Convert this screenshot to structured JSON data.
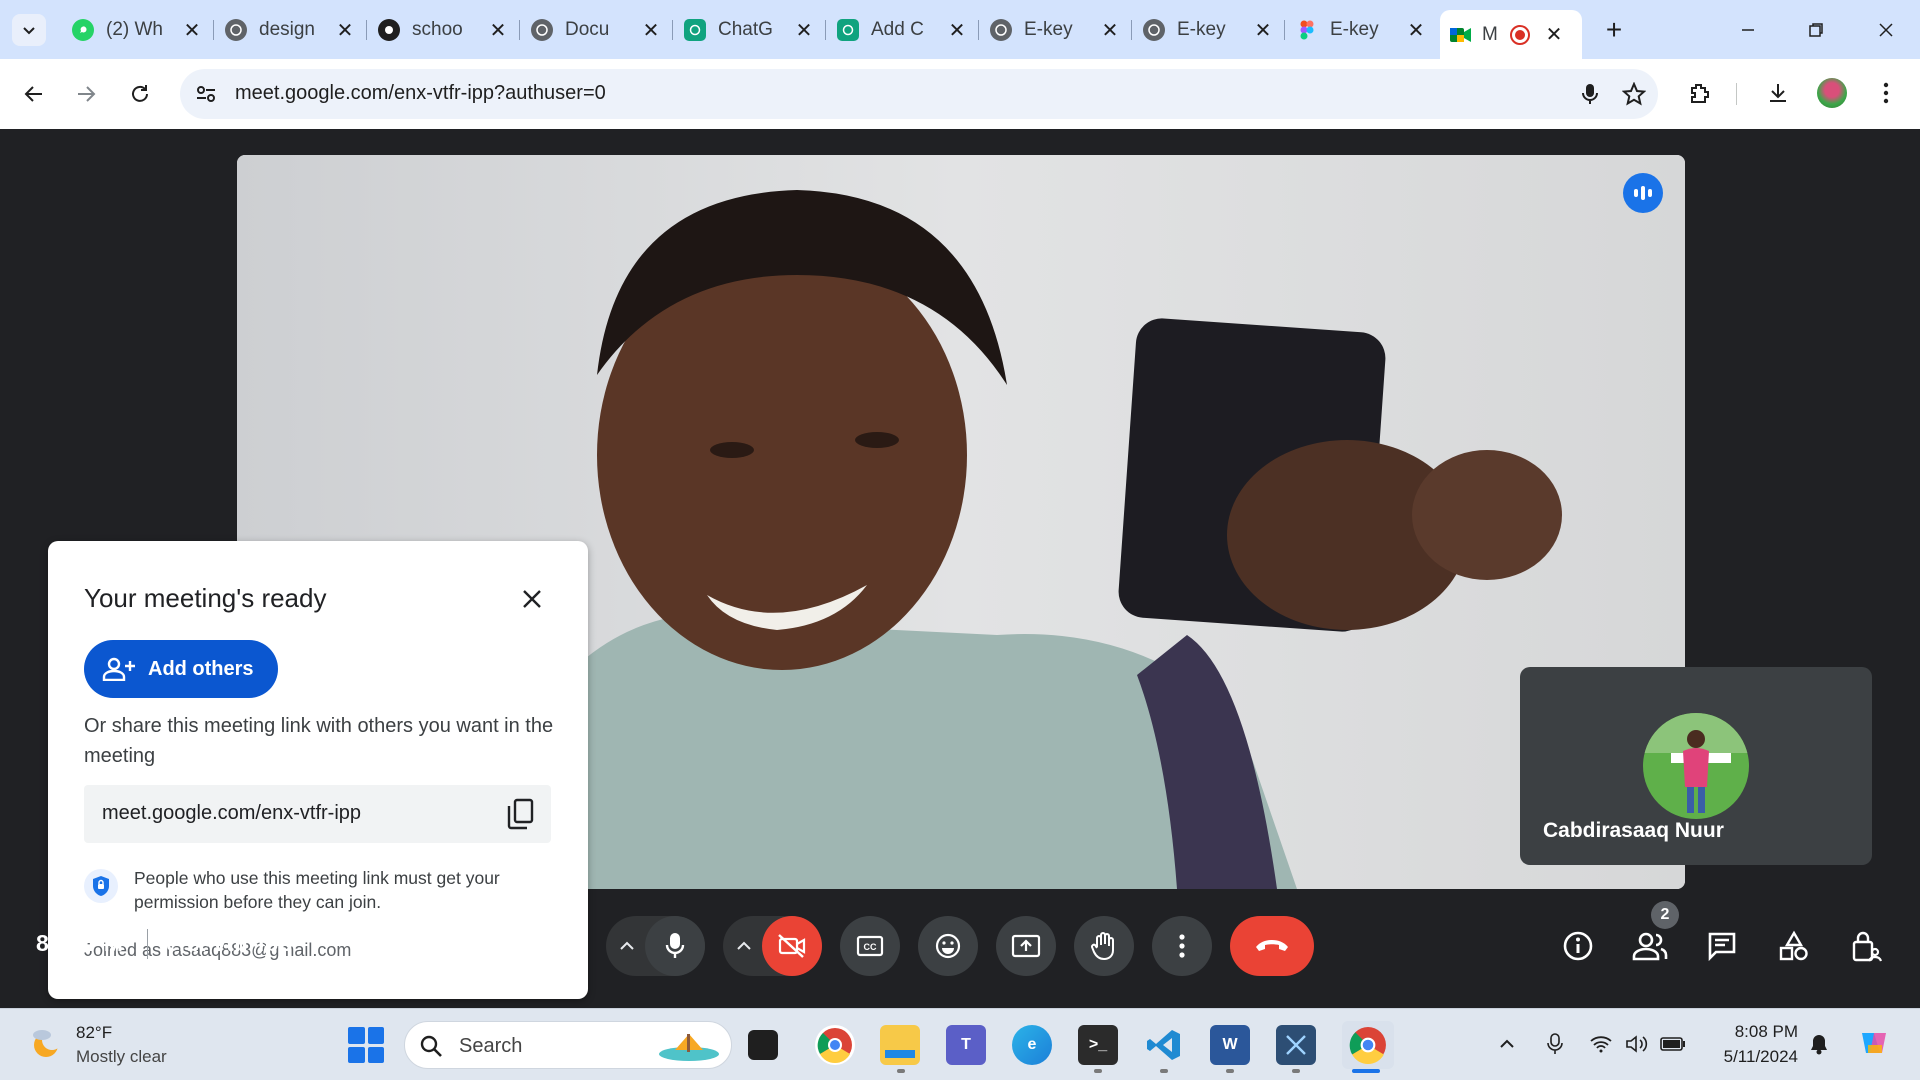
{
  "browser": {
    "tabs": [
      {
        "label": "(2) Wh",
        "icon": "whatsapp-icon",
        "color": "#25d366"
      },
      {
        "label": "design",
        "icon": "globe-icon",
        "color": "#5f6368"
      },
      {
        "label": "schoo",
        "icon": "github-icon",
        "color": "#1f1f1f"
      },
      {
        "label": "Docu",
        "icon": "globe-icon",
        "color": "#5f6368"
      },
      {
        "label": "ChatG",
        "icon": "chatgpt-icon",
        "color": "#10a37f"
      },
      {
        "label": "Add C",
        "icon": "chatgpt-icon",
        "color": "#10a37f"
      },
      {
        "label": "E-key",
        "icon": "globe-icon",
        "color": "#5f6368"
      },
      {
        "label": "E-key",
        "icon": "globe-icon",
        "color": "#5f6368"
      },
      {
        "label": "E-key",
        "icon": "figma-icon",
        "color": "#f24e1e"
      },
      {
        "label": "M",
        "icon": "google-meet-icon",
        "color": "#00832d",
        "active": true,
        "recording": true
      }
    ],
    "url": "meet.google.com/enx-vtfr-ipp?authuser=0"
  },
  "dialog": {
    "title": "Your meeting's ready",
    "add_others_label": "Add others",
    "share_text": "Or share this meeting link with others you want in the meeting",
    "link": "meet.google.com/enx-vtfr-ipp",
    "permission_text": "People who use this meeting link must get your permission before they can join.",
    "joined_text": "Joined as rasaaq883@gmail.com"
  },
  "self_tile": {
    "name": "Cabdirasaaq Nuur"
  },
  "controls": {
    "time": "8:08 PM",
    "meeting_code": "enx-vtfr-ipp",
    "participants_count": "2",
    "camera_state": "off",
    "end_call_color": "#ea4335",
    "accent_color": "#1a73e8"
  },
  "taskbar": {
    "weather_temp": "82°F",
    "weather_condition": "Mostly clear",
    "search_placeholder": "Search",
    "clock_time": "8:08 PM",
    "clock_date": "5/11/2024",
    "apps": [
      "task-view",
      "chrome",
      "file-explorer",
      "teams",
      "edge",
      "terminal",
      "vscode",
      "word",
      "snipping-tool",
      "chrome-active"
    ]
  }
}
